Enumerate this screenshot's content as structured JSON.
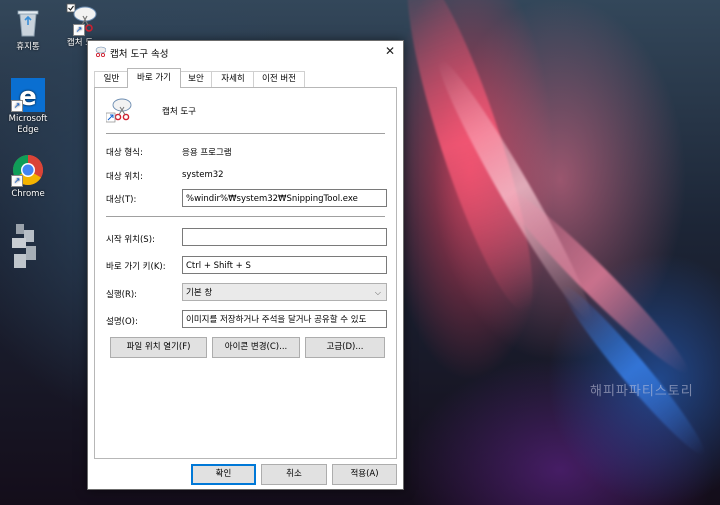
{
  "desktop": {
    "icons": [
      {
        "label": "휴지통"
      },
      {
        "label": "캡처 도"
      },
      {
        "label": "Microsoft Edge"
      },
      {
        "label": "Chrome"
      }
    ],
    "watermark": "해피파파티스토리"
  },
  "dialog": {
    "title": "캡처 도구 속성",
    "close_glyph": "✕",
    "tabs": [
      "일반",
      "바로 가기",
      "보안",
      "자세히",
      "이전 버전"
    ],
    "active_tab": "바로 가기",
    "app_name": "캡처 도구",
    "target_type_label": "대상 형식:",
    "target_type_value": "응용 프로그램",
    "target_location_label": "대상 위치:",
    "target_location_value": "system32",
    "target_label": "대상(T):",
    "target_value": "%windir%₩system32₩SnippingTool.exe",
    "start_in_label": "시작 위치(S):",
    "start_in_value": "",
    "shortcut_key_label": "바로 가기 키(K):",
    "shortcut_key_value": "Ctrl + Shift + S",
    "run_label": "실행(R):",
    "run_value": "기본 창",
    "comment_label": "설명(O):",
    "comment_value": "이미지를 저장하거나 주석을 달거나 공유할 수 있도",
    "buttons": {
      "open_location": "파일 위치 열기(F)",
      "change_icon": "아이콘 변경(C)...",
      "advanced": "고급(D)...",
      "ok": "확인",
      "cancel": "취소",
      "apply": "적용(A)"
    }
  },
  "colors": {
    "accent": "#0078d7",
    "edge_blue": "#0a6fd1",
    "recycle_gray": "#c9d3dc"
  }
}
